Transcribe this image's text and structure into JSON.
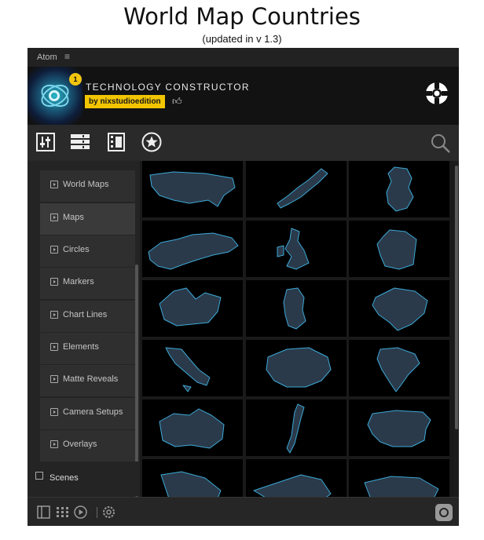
{
  "page": {
    "title": "World Map Countries",
    "subtitle": "(updated in v 1.3)"
  },
  "menubar": {
    "app_name": "Atom",
    "menu_icon": "hamburger-icon"
  },
  "banner": {
    "badge": "1",
    "brand": "TECHNOLOGY CONSTRUCTOR",
    "author": "by nixstudioedition",
    "like_icon": "thumbs-up-icon",
    "action_icon": "lifebuoy-icon"
  },
  "toolbar": {
    "icons": [
      "sliders-icon",
      "list-icon",
      "film-icon",
      "star-icon"
    ],
    "search_icon": "search-icon"
  },
  "sidebar": {
    "items": [
      {
        "label": "World Maps"
      },
      {
        "label": "Maps"
      },
      {
        "label": "Circles"
      },
      {
        "label": "Markers"
      },
      {
        "label": "Chart Lines"
      },
      {
        "label": "Elements"
      },
      {
        "label": "Matte Reveals"
      },
      {
        "label": "Camera Setups"
      },
      {
        "label": "Overlays"
      }
    ],
    "active_item": "Maps",
    "scenes_label": "Scenes"
  },
  "grid": {
    "thumbnails": [
      "usa-map-icon",
      "japan-map-icon",
      "germany-map-icon",
      "russia-map-icon",
      "uk-map-icon",
      "france-map-icon",
      "canada-map-icon",
      "south-korea-map-icon",
      "brazil-map-icon",
      "italy-map-icon",
      "china-map-icon",
      "india-map-icon",
      "australia-map-icon",
      "chile-map-icon",
      "spain-map-icon",
      "map-thumbnail-icon",
      "map-thumbnail-icon",
      "map-thumbnail-icon"
    ]
  },
  "footer": {
    "icons": [
      "panel-icon",
      "grid-icon",
      "play-icon",
      "settings-icon"
    ],
    "right_icon": "app-logo-icon"
  },
  "colors": {
    "background": "#1c1c1c",
    "accent": "#f2c500",
    "map_fill": "#2a3a4a",
    "map_border": "#3da9d8"
  }
}
